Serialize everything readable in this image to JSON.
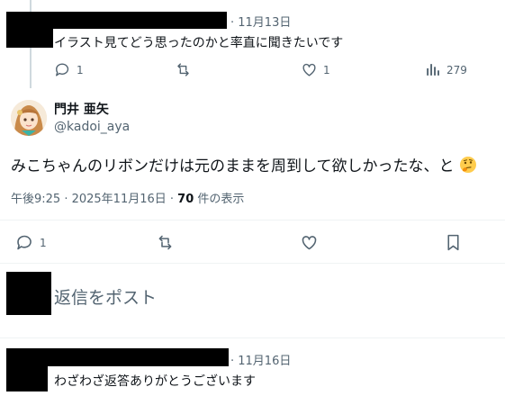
{
  "tweet1": {
    "date": "· 11月13日",
    "text": "イラスト見てどう思ったのかと率直に聞きたいです",
    "replies": "1",
    "likes": "1",
    "views": "279"
  },
  "main_tweet": {
    "name": "門井 亜矢",
    "handle": "@kadoi_aya",
    "text": "みこちゃんのリボンだけは元のままを周到して欲しかったな、と",
    "emoji": "thinking-face",
    "timestamp": "午後9:25 · 2025年11月16日 · ",
    "views_count": "70",
    "views_label": " 件の表示",
    "replies": "1"
  },
  "reply_composer": {
    "placeholder": "返信をポスト"
  },
  "tweet2": {
    "date": "· 11月16日",
    "text": "わざわざ返答ありがとうございます"
  },
  "colors": {
    "muted": "#536471",
    "text": "#0f1419",
    "divider": "#eff3f4",
    "redaction": "#000000"
  }
}
